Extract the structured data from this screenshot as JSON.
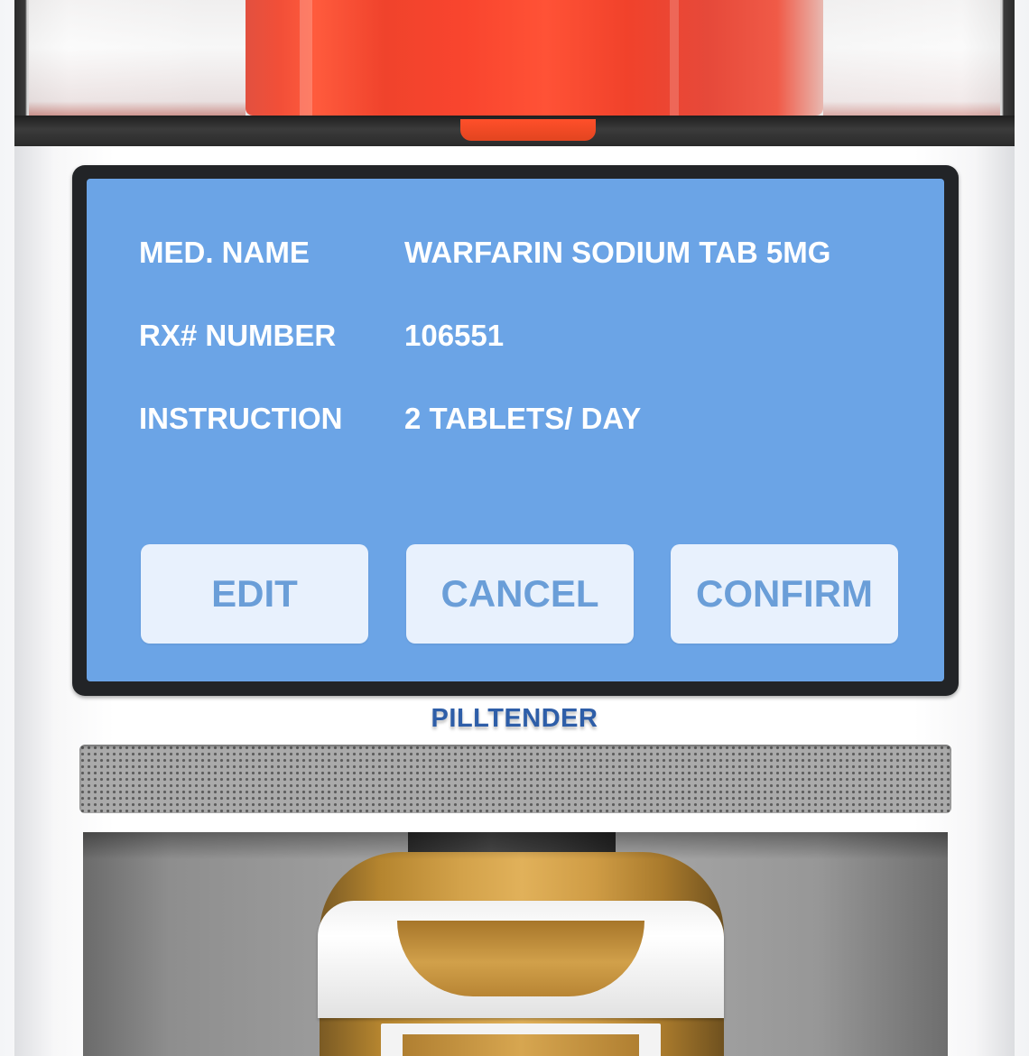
{
  "screen": {
    "fields": [
      {
        "label": "MED. NAME",
        "value": "WARFARIN SODIUM TAB 5MG"
      },
      {
        "label": "RX# NUMBER",
        "value": "106551"
      },
      {
        "label": "INSTRUCTION",
        "value": "2 TABLETS/ DAY"
      }
    ],
    "buttons": {
      "edit": "EDIT",
      "cancel": "CANCEL",
      "confirm": "CONFIRM"
    }
  },
  "brand": "PILLTENDER",
  "colors": {
    "screen_background": "#6ba4e6",
    "button_background": "#e8f1fd",
    "button_text": "#6a9ed8",
    "brand_text": "#2e5ea8",
    "reservoir_liquid": "#f24f38"
  }
}
